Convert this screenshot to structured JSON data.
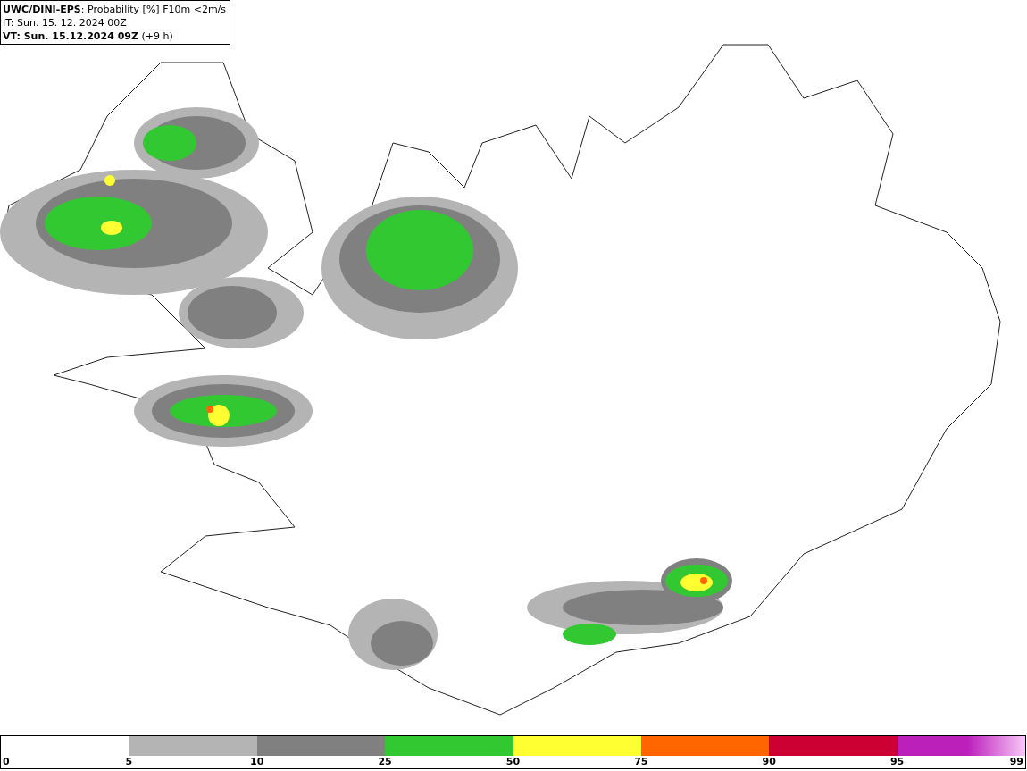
{
  "header": {
    "title": "**UWC/DINI-EPS**: Probability [%] F10m <2m/s",
    "init_time": "IT: Sun. 15. 12. 2024 00Z",
    "valid_time": "**VT: Sun. 15.12.2024 09Z** (+9 h)"
  },
  "legend": {
    "segments": [
      {
        "color": "#b4b4b4"
      },
      {
        "color": "#808080"
      },
      {
        "color": "#32c832"
      },
      {
        "color": "#ffff32"
      },
      {
        "color": "#ff6600"
      },
      {
        "color": "#cc0033"
      },
      {
        "color": "#bb20bb"
      }
    ],
    "labels": [
      "0",
      "5",
      "10",
      "25",
      "50",
      "75",
      "90",
      "95",
      "99"
    ]
  }
}
